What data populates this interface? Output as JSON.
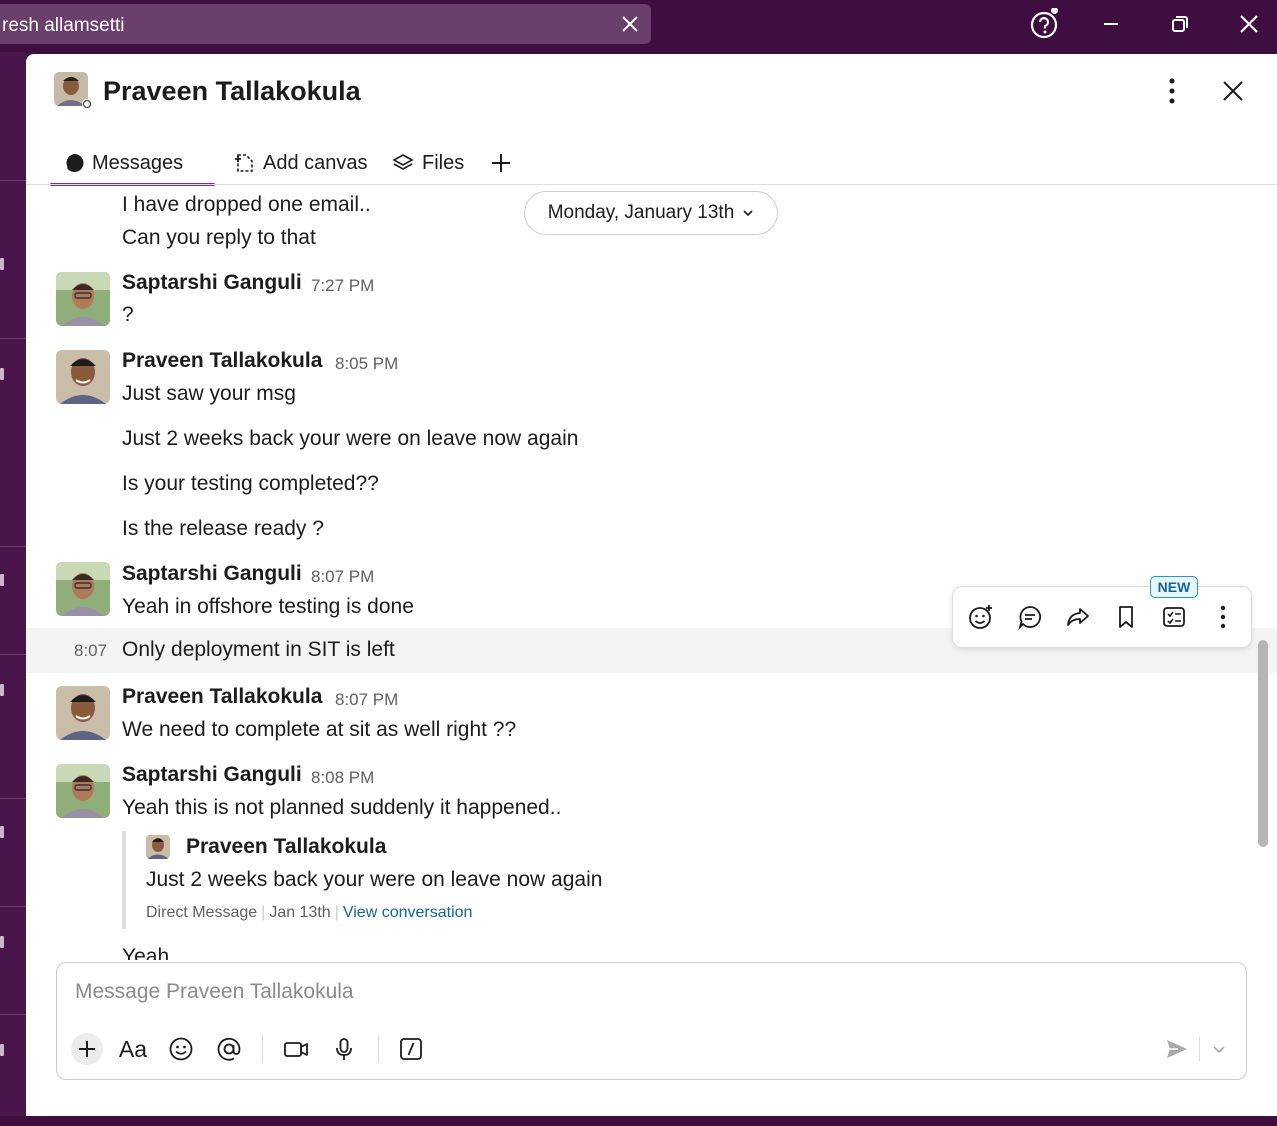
{
  "titlebar": {
    "search_text": "resh allamsetti",
    "icons": [
      "close-icon",
      "help-icon",
      "minimize-icon",
      "restore-icon",
      "window-close-icon"
    ]
  },
  "header": {
    "title": "Praveen Tallakokula",
    "status": "away"
  },
  "tabs": [
    {
      "label": "Messages",
      "icon": "message-bubble-icon",
      "active": true
    },
    {
      "label": "Add canvas",
      "icon": "canvas-icon",
      "active": false
    },
    {
      "label": "Files",
      "icon": "layers-icon",
      "active": false
    }
  ],
  "date_divider": "Monday, January 13th",
  "messages": {
    "top_lines": [
      "I have dropped one email..",
      "Can you reply to that"
    ],
    "m1": {
      "author": "Saptarshi Ganguli",
      "time": "7:27 PM",
      "lines": [
        "?"
      ]
    },
    "m2": {
      "author": "Praveen Tallakokula",
      "time": "8:05 PM",
      "lines": [
        "Just saw your msg",
        "Just 2 weeks back your were on leave now again",
        "Is your testing completed??",
        "Is the release ready ?"
      ]
    },
    "m3": {
      "author": "Saptarshi Ganguli",
      "time": "8:07 PM",
      "lines": [
        "Yeah in offshore testing is done"
      ]
    },
    "m3b": {
      "short_time": "8:07",
      "text": "Only deployment in SIT is left"
    },
    "m4": {
      "author": "Praveen Tallakokula",
      "time": "8:07 PM",
      "lines": [
        "We need to complete at sit as well right ??"
      ]
    },
    "m5": {
      "author": "Saptarshi Ganguli",
      "time": "8:08 PM",
      "lines": [
        "Yeah this is not planned suddenly it happened.."
      ],
      "quote": {
        "author": "Praveen Tallakokula",
        "text": "Just 2 weeks back your were on leave now again",
        "source": "Direct Message",
        "date": "Jan 13th",
        "link": "View conversation"
      }
    },
    "cut_off_text": "Yeah"
  },
  "message_actions": {
    "badge": "NEW",
    "icons": [
      "add-reaction-icon",
      "reply-thread-icon",
      "forward-icon",
      "bookmark-icon",
      "add-to-list-icon",
      "more-actions-icon"
    ]
  },
  "composer": {
    "placeholder": "Message Praveen Tallakokula",
    "format_label": "Aa",
    "tools": [
      "plus-icon",
      "format-icon",
      "emoji-icon",
      "mention-icon",
      "video-icon",
      "microphone-icon",
      "slash-command-icon",
      "send-icon",
      "send-options-icon"
    ]
  },
  "colors": {
    "titlebar": "#3f0e40",
    "sidebar": "#4a154b",
    "accent": "#7c3085",
    "link": "#1264a3"
  }
}
